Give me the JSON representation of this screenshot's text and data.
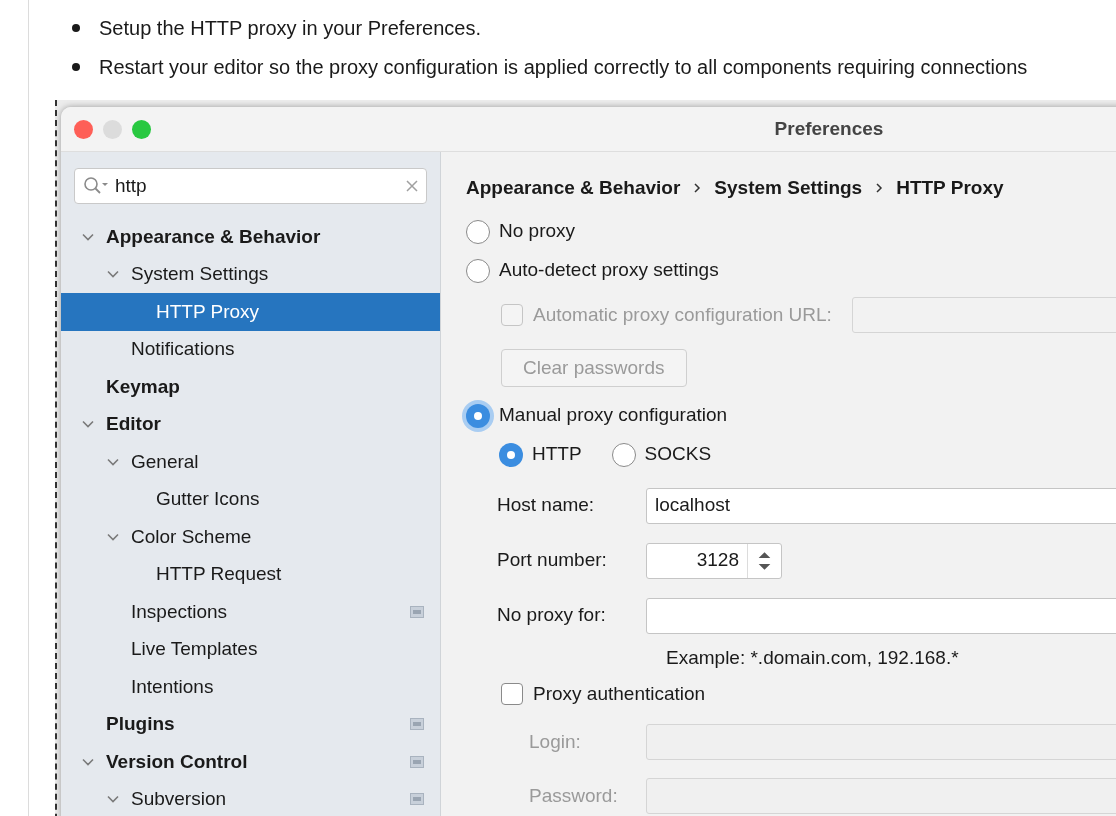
{
  "bullets": [
    "Setup the HTTP proxy in your Preferences.",
    "Restart your editor so the proxy configuration is applied correctly to all components requiring connections"
  ],
  "window": {
    "title": "Preferences"
  },
  "search": {
    "value": "http"
  },
  "tree": [
    {
      "label": "Appearance & Behavior",
      "expanded": true,
      "selected": false,
      "children": [
        {
          "label": "System Settings",
          "expanded": true,
          "selected": false,
          "children": [
            {
              "label": "HTTP Proxy",
              "selected": true,
              "project": false
            }
          ]
        },
        {
          "label": "Notifications",
          "selected": false,
          "project": false
        }
      ]
    },
    {
      "label": "Keymap",
      "selected": false,
      "project": false
    },
    {
      "label": "Editor",
      "expanded": true,
      "selected": false,
      "children": [
        {
          "label": "General",
          "expanded": true,
          "selected": false,
          "children": [
            {
              "label": "Gutter Icons",
              "selected": false,
              "project": false
            }
          ]
        },
        {
          "label": "Color Scheme",
          "expanded": true,
          "selected": false,
          "children": [
            {
              "label": "HTTP Request",
              "selected": false,
              "project": false
            }
          ]
        },
        {
          "label": "Inspections",
          "selected": false,
          "project": true
        },
        {
          "label": "Live Templates",
          "selected": false,
          "project": false
        },
        {
          "label": "Intentions",
          "selected": false,
          "project": false
        }
      ]
    },
    {
      "label": "Plugins",
      "selected": false,
      "project": true
    },
    {
      "label": "Version Control",
      "expanded": true,
      "selected": false,
      "project": true,
      "children": [
        {
          "label": "Subversion",
          "expanded": true,
          "selected": false,
          "project": true
        }
      ]
    }
  ],
  "breadcrumbs": [
    "Appearance & Behavior",
    "System Settings",
    "HTTP Proxy"
  ],
  "proxy_modes": [
    {
      "label": "No proxy",
      "selected": false
    },
    {
      "label": "Auto-detect proxy settings",
      "selected": false
    },
    {
      "label": "Manual proxy configuration",
      "selected": true
    }
  ],
  "auto_config": {
    "label": "Automatic proxy configuration URL:",
    "checked": false,
    "disabled": true
  },
  "clear_passwords": {
    "label": "Clear passwords",
    "disabled": true
  },
  "protocols": [
    {
      "label": "HTTP",
      "selected": true
    },
    {
      "label": "SOCKS",
      "selected": false
    }
  ],
  "fields": [
    {
      "label": "Host name:",
      "value": "localhost",
      "kind": "text"
    },
    {
      "label": "Port number:",
      "value": "3128",
      "kind": "spinner"
    },
    {
      "label": "No proxy for:",
      "kind": "text"
    }
  ],
  "example": "Example: *.domain.com, 192.168.*",
  "proxy_auth": {
    "label": "Proxy authentication",
    "checked": false
  },
  "auth_fields": [
    {
      "label": "Login:",
      "disabled": true
    },
    {
      "label": "Password:",
      "disabled": true
    }
  ]
}
